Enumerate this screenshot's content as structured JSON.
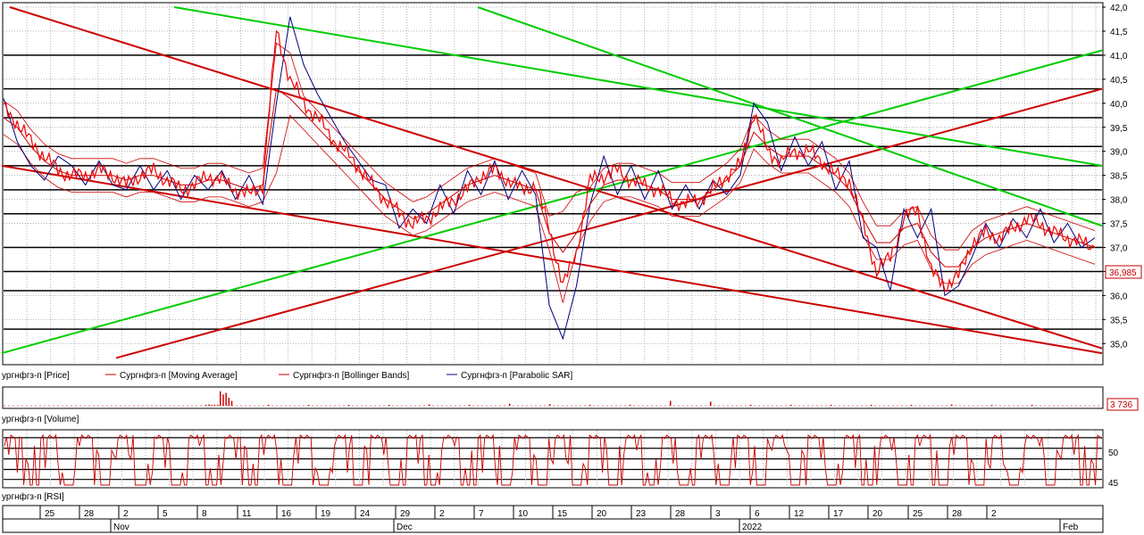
{
  "chart_data": [
    {
      "type": "line",
      "panel": "price",
      "title": "",
      "ylim": [
        34.7,
        42.0
      ],
      "yticks": [
        "35,0",
        "35,5",
        "36,0",
        "36,5",
        "37,0",
        "37,5",
        "38,0",
        "38,5",
        "39,0",
        "39,5",
        "40,0",
        "40,5",
        "41,0",
        "41,5",
        "42,0"
      ],
      "last_value_label": "36,985",
      "last_value": 36.985,
      "horizontal_levels": [
        41.0,
        40.3,
        39.7,
        39.1,
        38.7,
        38.2,
        37.7,
        37.0,
        36.5,
        36.1,
        35.3
      ],
      "grid": true,
      "legend": [
        {
          "name": "ургнфгз-п [Price]",
          "color": "#cc0000"
        },
        {
          "name": "Сургнфгз-п [Moving Average]",
          "color": "#cc0000"
        },
        {
          "name": "Сургнфгз-п [Bollinger Bands]",
          "color": "#cc0000"
        },
        {
          "name": "Сургнфгз-п [Parabolic SAR]",
          "color": "#000080"
        }
      ],
      "legend_position": "bottom",
      "series": [
        {
          "name": "Price",
          "color": "#ee0000",
          "values": [
            39.9,
            39.6,
            39.2,
            38.9,
            38.6,
            38.5,
            38.5,
            38.6,
            38.5,
            38.3,
            38.5,
            38.6,
            38.4,
            38.2,
            38.3,
            38.5,
            38.4,
            38.2,
            38.1,
            38.3,
            41.5,
            40.5,
            40.0,
            39.7,
            39.3,
            39.0,
            38.7,
            38.3,
            38.0,
            37.7,
            37.5,
            37.6,
            37.8,
            38.0,
            38.2,
            38.5,
            38.6,
            38.4,
            38.2,
            38.3,
            37.4,
            36.2,
            36.9,
            38.4,
            38.5,
            38.6,
            38.4,
            38.3,
            38.2,
            38.0,
            37.9,
            38.0,
            38.2,
            38.5,
            38.7,
            39.8,
            39.0,
            38.8,
            39.0,
            39.0,
            38.8,
            38.5,
            38.4,
            37.5,
            36.5,
            36.8,
            37.6,
            37.8,
            36.5,
            36.2,
            36.4,
            37.1,
            37.3,
            37.2,
            37.4,
            37.6,
            37.5,
            37.3,
            37.2,
            37.1,
            37.0
          ]
        },
        {
          "name": "Moving Average",
          "color": "#cc0000",
          "values": [
            39.7,
            39.5,
            39.1,
            38.8,
            38.6,
            38.5,
            38.5,
            38.5,
            38.5,
            38.4,
            38.5,
            38.5,
            38.4,
            38.3,
            38.3,
            38.4,
            38.4,
            38.3,
            38.2,
            38.3,
            40.3,
            40.1,
            39.8,
            39.5,
            39.2,
            38.9,
            38.6,
            38.3,
            38.0,
            37.8,
            37.6,
            37.7,
            37.9,
            38.1,
            38.3,
            38.4,
            38.5,
            38.4,
            38.3,
            38.2,
            37.3,
            36.9,
            37.3,
            37.9,
            38.3,
            38.4,
            38.4,
            38.3,
            38.2,
            38.0,
            38.0,
            38.0,
            38.2,
            38.4,
            38.7,
            39.4,
            39.1,
            38.9,
            38.9,
            38.9,
            38.7,
            38.5,
            38.2,
            37.6,
            37.1,
            37.1,
            37.4,
            37.5,
            36.9,
            36.6,
            36.6,
            37.0,
            37.2,
            37.3,
            37.4,
            37.5,
            37.4,
            37.3,
            37.2,
            37.1,
            37.0
          ]
        },
        {
          "name": "Parabolic SAR",
          "color": "#000080",
          "values": [
            40.1,
            39.2,
            38.7,
            38.4,
            38.9,
            38.7,
            38.3,
            38.8,
            38.3,
            38.2,
            38.7,
            38.2,
            38.6,
            38.0,
            38.5,
            38.2,
            38.6,
            38.0,
            38.5,
            37.9,
            40.0,
            41.8,
            40.8,
            40.2,
            39.7,
            39.2,
            38.8,
            38.4,
            38.3,
            37.4,
            37.8,
            37.5,
            38.3,
            37.7,
            38.6,
            38.1,
            38.8,
            38.0,
            38.6,
            38.1,
            35.8,
            35.1,
            36.2,
            37.9,
            38.9,
            38.1,
            38.7,
            38.0,
            38.6,
            37.8,
            38.3,
            37.8,
            38.4,
            38.1,
            38.5,
            40.0,
            39.6,
            38.6,
            39.3,
            38.7,
            39.2,
            38.2,
            38.8,
            37.2,
            37.0,
            36.1,
            37.8,
            37.2,
            37.8,
            36.0,
            36.2,
            36.8,
            37.5,
            37.0,
            37.6,
            37.2,
            37.8,
            37.1,
            37.5,
            37.0,
            37.2
          ]
        }
      ],
      "trendlines": [
        {
          "color": "#cc0000",
          "from": [
            11.0,
            42.0
          ],
          "to": [
            1234.0,
            34.9
          ]
        },
        {
          "color": "#cc0000",
          "from": [
            2.0,
            38.7
          ],
          "to": [
            1234.0,
            34.8
          ]
        },
        {
          "color": "#cc0000",
          "from": [
            130.0,
            34.7
          ],
          "to": [
            1234.0,
            40.3
          ]
        },
        {
          "color": "#00cc00",
          "from": [
            2.0,
            34.8
          ],
          "to": [
            1234.0,
            41.1
          ]
        },
        {
          "color": "#00cc00",
          "from": [
            195.0,
            42.0
          ],
          "to": [
            1234.0,
            38.7
          ]
        },
        {
          "color": "#00cc00",
          "from": [
            535.0,
            42.0
          ],
          "to": [
            1234.0,
            37.45
          ]
        }
      ]
    },
    {
      "type": "bar",
      "panel": "volume",
      "legend": "ургнфгз-п [Volume]",
      "last_value_label": "3 736",
      "spikes": [
        0.05,
        0.08,
        0.03,
        0.06,
        0.04,
        0.9,
        0.7,
        0.8,
        0.5,
        0.3,
        0.06,
        0.04,
        0.05,
        0.03,
        0.08,
        0.06,
        0.12,
        0.1,
        0.05,
        0.04,
        0.3,
        0.25,
        0.06,
        0.05,
        0.04,
        0.06,
        0.05,
        0.08,
        0.04,
        0.05
      ]
    },
    {
      "type": "line",
      "panel": "rsi",
      "legend": "ургнфгз-п [RSI]",
      "ylim": [
        44.5,
        53.5
      ],
      "yticks": [
        "45",
        "50"
      ],
      "levels": [
        45.5,
        47.2,
        49.0,
        50.8,
        52.6
      ]
    }
  ],
  "x_axis": {
    "day_labels": [
      "25",
      "28",
      "2",
      "5",
      "8",
      "11",
      "16",
      "19",
      "24",
      "29",
      "2",
      "7",
      "10",
      "15",
      "20",
      "23",
      "28",
      "3",
      "6",
      "12",
      "17",
      "20",
      "25",
      "28",
      "2"
    ],
    "month_labels": [
      "Nov",
      "Dec",
      "2022",
      "Feb"
    ]
  },
  "colors": {
    "price": "#ee0000",
    "sar": "#000080",
    "support": "#cc0000",
    "resistance": "#00cc00",
    "grid": "#b0b0b0",
    "level": "#000000"
  }
}
